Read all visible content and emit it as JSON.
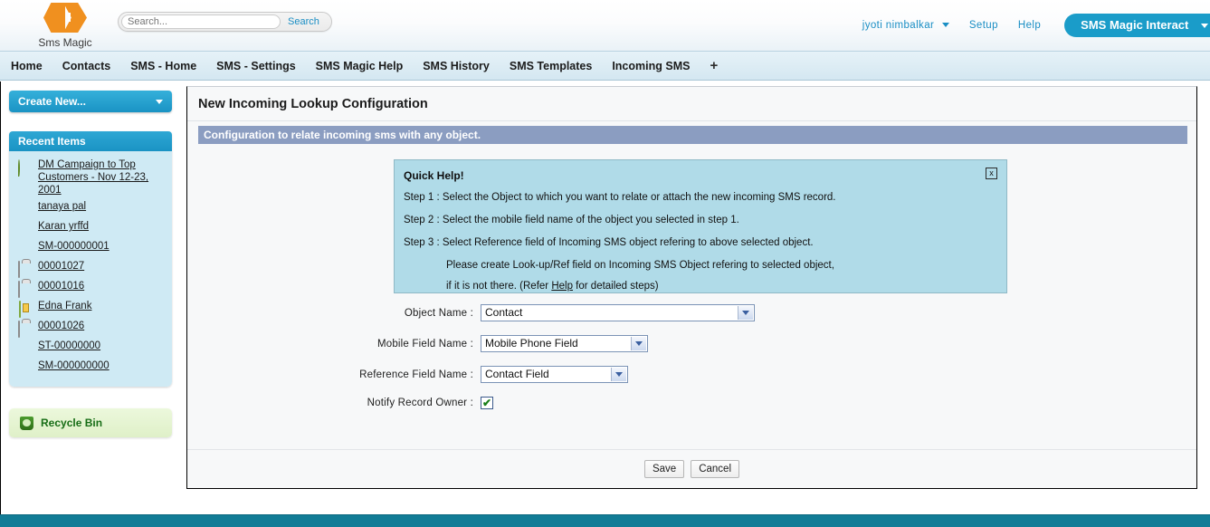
{
  "header": {
    "logo_text": "Sms Magic",
    "search": {
      "placeholder": "Search...",
      "button_label": "Search"
    },
    "user_name": "jyoti nimbalkar",
    "setup_label": "Setup",
    "help_label": "Help",
    "app_label": "SMS Magic Interact"
  },
  "tabs": [
    {
      "label": "Home"
    },
    {
      "label": "Contacts"
    },
    {
      "label": "SMS - Home"
    },
    {
      "label": "SMS - Settings"
    },
    {
      "label": "SMS Magic Help"
    },
    {
      "label": "SMS History"
    },
    {
      "label": "SMS Templates"
    },
    {
      "label": "Incoming SMS"
    }
  ],
  "tab_add_label": "+",
  "sidebar": {
    "create_new_label": "Create New...",
    "recent_items_header": "Recent Items",
    "recent_items": [
      {
        "label": "DM Campaign to Top Customers - Nov 12-23, 2001",
        "icon": "campaign-icon"
      },
      {
        "label": "tanaya pal",
        "icon": "contact-icon"
      },
      {
        "label": "Karan yrffd",
        "icon": "contact-icon"
      },
      {
        "label": "SM-000000001",
        "icon": "sms-icon"
      },
      {
        "label": "00001027",
        "icon": "case-icon"
      },
      {
        "label": "00001016",
        "icon": "case-icon"
      },
      {
        "label": "Edna Frank",
        "icon": "lead-icon"
      },
      {
        "label": "00001026",
        "icon": "case-icon"
      },
      {
        "label": "ST-00000000",
        "icon": "sms-icon"
      },
      {
        "label": "SM-000000000",
        "icon": "sms-icon"
      }
    ],
    "recycle_bin_label": "Recycle Bin"
  },
  "main": {
    "page_title": "New Incoming Lookup Configuration",
    "section_title": "Configuration to relate incoming sms with any object.",
    "quick_help": {
      "title": "Quick Help!",
      "step1": "Step 1 :  Select the Object to which you want to relate or attach the new incoming SMS record.",
      "step2": "Step 2 :  Select the mobile field name of the object you selected in step 1.",
      "step3": "Step 3 :  Select Reference field of Incoming SMS object refering to above selected object.",
      "step3_line2": "Please create Look-up/Ref field on Incoming SMS Object refering to selected object,",
      "step3_line3_pre": "if it is not there. (Refer ",
      "step3_link": "Help",
      "step3_line3_post": " for detailed steps)",
      "close_label": "x"
    },
    "form": {
      "object_name_label": "Object Name :",
      "object_name_value": "Contact",
      "mobile_field_label": "Mobile Field Name :",
      "mobile_field_value": "Mobile Phone Field",
      "reference_field_label": "Reference Field Name :",
      "reference_field_value": "Contact Field",
      "notify_label": "Notify Record Owner :",
      "notify_checked_glyph": "✔"
    },
    "save_label": "Save",
    "cancel_label": "Cancel"
  },
  "colors": {
    "brand_orange": "#f0901f",
    "brand_teal": "#1a93c4",
    "section_bar": "#8b9dc1",
    "quick_help_bg": "#b0dbe8",
    "footer_strip": "#127c96"
  }
}
